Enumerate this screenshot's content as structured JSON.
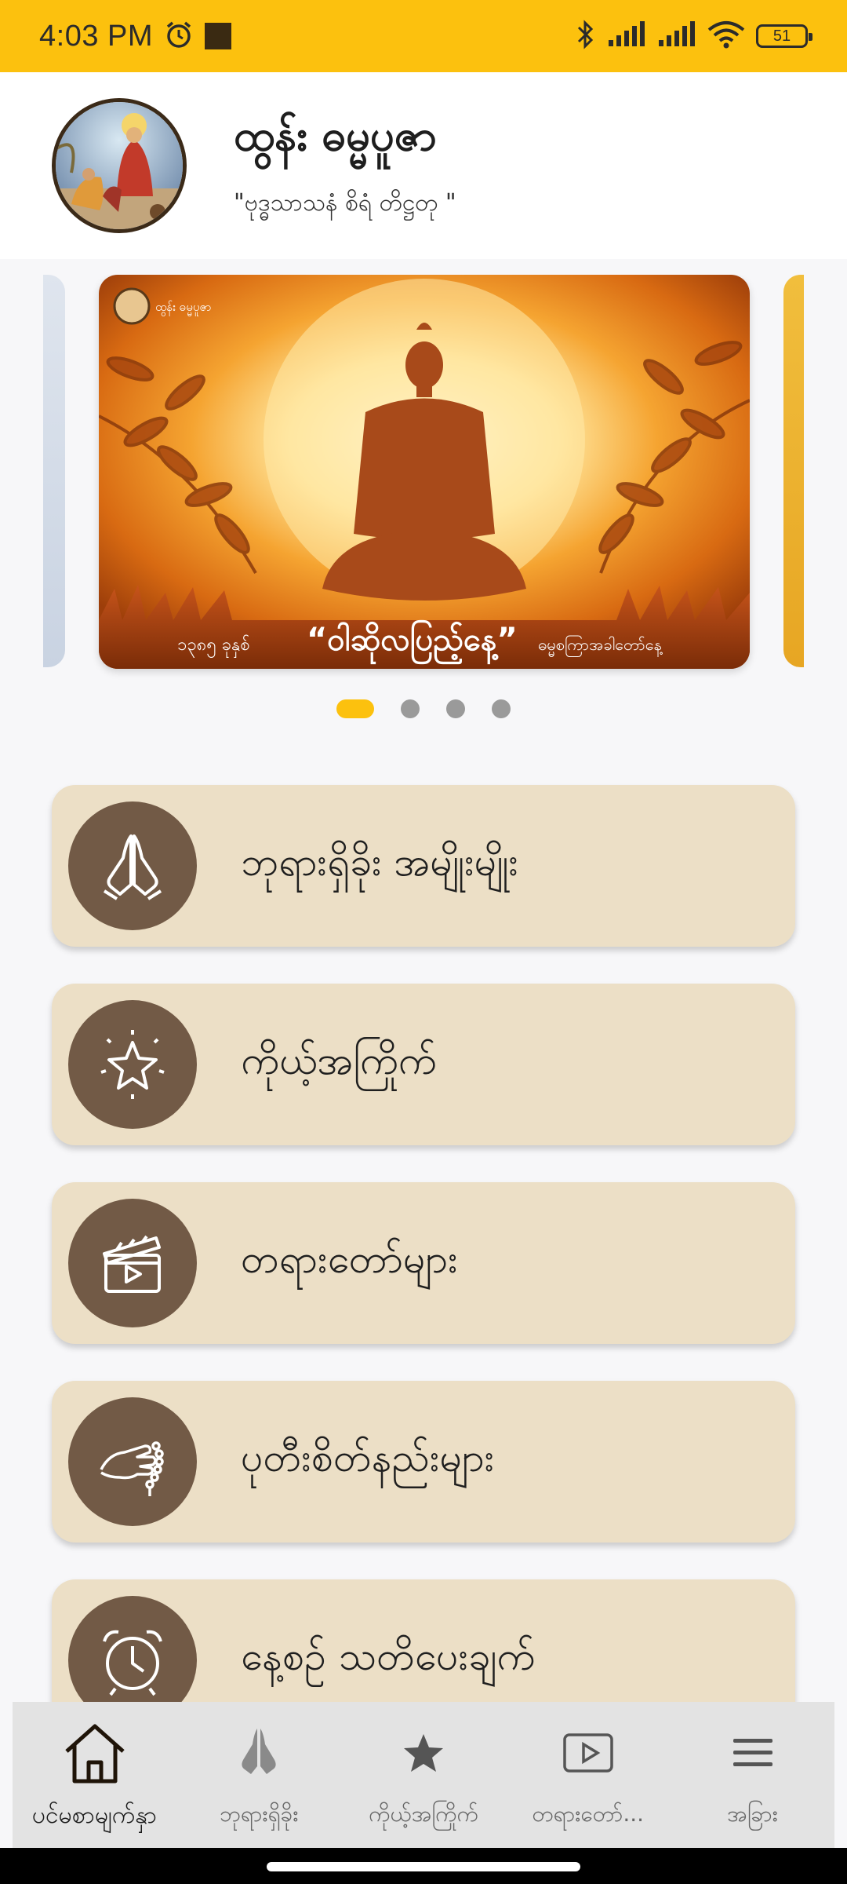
{
  "status_bar": {
    "time": "4:03 PM",
    "battery": "51",
    "icons": [
      "alarm-icon",
      "notification-square-icon",
      "bluetooth-icon",
      "signal-icon",
      "signal-icon",
      "wifi-icon",
      "battery-icon"
    ]
  },
  "header": {
    "title": "ထွန်း ဓမ္မပူဇာ",
    "subtitle": "\"ဗုဒ္ဓသာသနံ စိရံ တိဋ္ဌတု \""
  },
  "carousel": {
    "slide_logo_text": "ထွန်း ဓမ္မပူဇာ",
    "slide_year": "၁၃၈၅ ခုနှစ်",
    "slide_title": "“ဝါဆိုလပြည့်နေ့”",
    "slide_sub": "ဓမ္မစကြာအခါတော်နေ့",
    "dots_count": 4,
    "active_index": 0
  },
  "menu": [
    {
      "label": "ဘုရားရှိခိုး အမျိုးမျိုး",
      "icon": "praying-hands-icon"
    },
    {
      "label": "ကိုယ့်အကြိုက်",
      "icon": "star-icon"
    },
    {
      "label": "တရားတော်များ",
      "icon": "clapperboard-icon"
    },
    {
      "label": "ပုတီးစိတ်နည်းများ",
      "icon": "prayer-beads-icon"
    },
    {
      "label": "နေ့စဉ် သတိပေးချက်",
      "icon": "alarm-clock-icon"
    }
  ],
  "bottom_nav": [
    {
      "label": "ပင်မစာမျက်နှာ",
      "icon": "home-icon",
      "active": true
    },
    {
      "label": "ဘုရားရှိခိုး",
      "icon": "praying-hands-icon",
      "active": false
    },
    {
      "label": "ကိုယ့်အကြိုက်",
      "icon": "star-icon",
      "active": false
    },
    {
      "label": "တရားတော်...",
      "icon": "play-icon",
      "active": false
    },
    {
      "label": "အခြား",
      "icon": "menu-icon",
      "active": false
    }
  ],
  "colors": {
    "accent": "#fcc10e",
    "card_bg": "#ecdfc6",
    "icon_circle": "#725a46"
  }
}
